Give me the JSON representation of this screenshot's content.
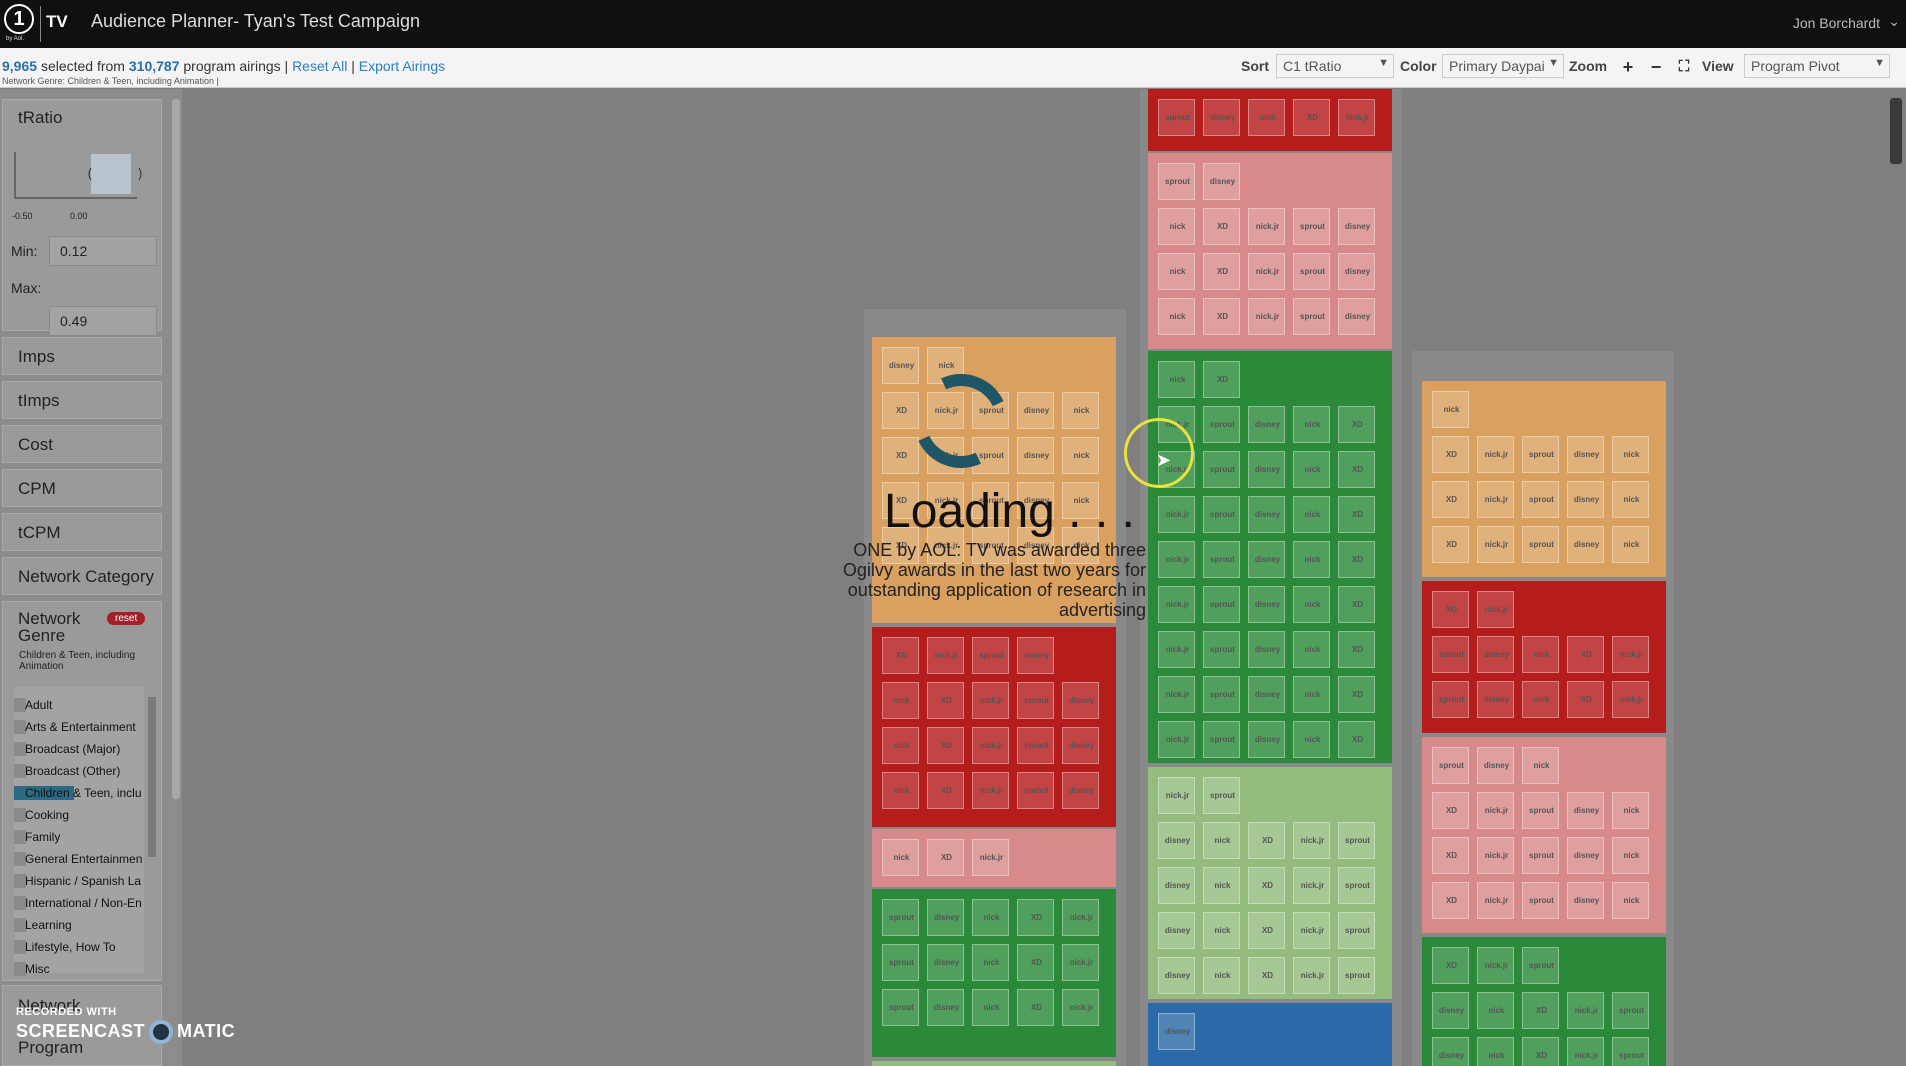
{
  "app": {
    "logo_text": "1",
    "logo_sub": "by Aol.",
    "product": "TV",
    "title": "Audience Planner- Tyan's Test Campaign",
    "user": "Jon Borchardt"
  },
  "selection": {
    "selected_count": "9,965",
    "selected_mid": "selected from",
    "total_count": "310,787",
    "total_suffix": "program airings |",
    "reset_all": "Reset All",
    "separator": "|",
    "export": "Export Airings",
    "filter_note": "Network Genre: Children & Teen, including Animation |"
  },
  "controls": {
    "sort_label": "Sort",
    "sort_value": "C1 tRatio",
    "color_label": "Color",
    "color_value": "Primary Daypai",
    "zoom_label": "Zoom",
    "zoom_in": "+",
    "zoom_out": "−",
    "fullscreen": "⛶",
    "view_label": "View",
    "view_value": "Program Pivot"
  },
  "sidebar": {
    "tratio": {
      "label": "tRatio",
      "tick_left": "-0.50",
      "tick_right": "0.00",
      "min_label": "Min:",
      "min_value": "0.12",
      "max_label": "Max:",
      "max_value": "0.49"
    },
    "metrics": [
      "Imps",
      "tImps",
      "Cost",
      "CPM",
      "tCPM",
      "Network Category"
    ],
    "genre": {
      "label": "Network Genre",
      "reset": "reset",
      "subtitle": "Children & Teen, including Animation",
      "items": [
        {
          "label": "Adult"
        },
        {
          "label": "Arts & Entertainment"
        },
        {
          "label": "Broadcast (Major)"
        },
        {
          "label": "Broadcast (Other)"
        },
        {
          "label": "Children & Teen, inclu"
        },
        {
          "label": "Cooking"
        },
        {
          "label": "Family"
        },
        {
          "label": "General Entertainmen"
        },
        {
          "label": "Hispanic / Spanish La"
        },
        {
          "label": "International / Non-En"
        },
        {
          "label": "Learning"
        },
        {
          "label": "Lifestyle, How To"
        },
        {
          "label": "Misc"
        }
      ],
      "active_index": 4
    },
    "network_label": "Network",
    "program_label": "Program"
  },
  "loading": {
    "title": "Loading . . .",
    "note": "ONE by AOL: TV was awarded three Ogilvy awards in the last two years for outstanding application of research in advertising"
  },
  "watermark": {
    "line1": "RECORDED WITH",
    "line2a": "SCREENCAST",
    "line2b": "MATIC"
  },
  "colors": {
    "orange": "#d9a05f",
    "red": "#b51c1c",
    "pink": "#d88a8a",
    "green": "#2a8a3a",
    "lightgreen": "#93bc7e",
    "blue": "#2a6aa8"
  },
  "tile_labels": [
    "disney",
    "nick",
    "XD",
    "nick.jr",
    "sprout"
  ]
}
